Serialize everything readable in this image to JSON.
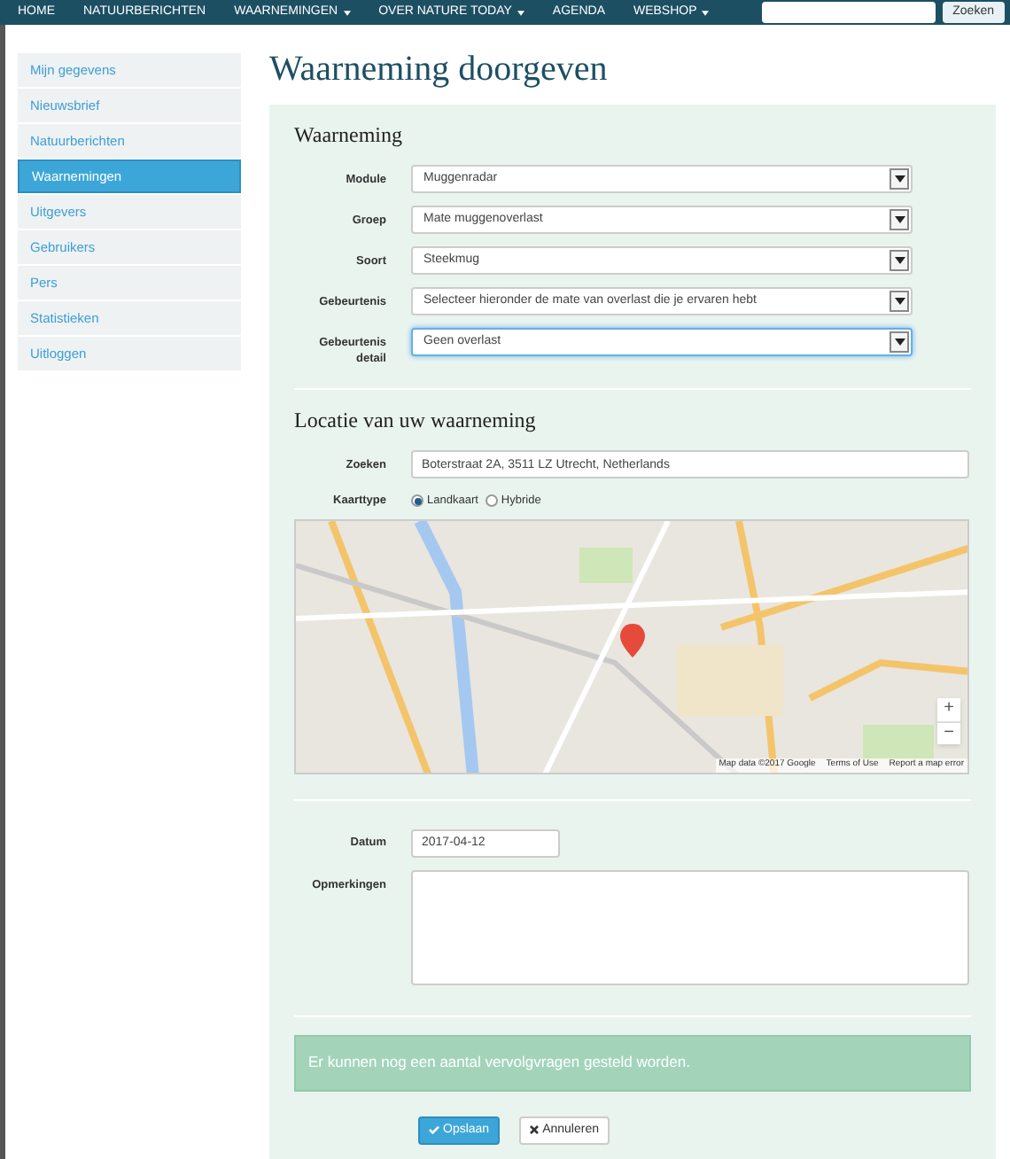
{
  "navbar": {
    "items": [
      {
        "label": "HOME",
        "dropdown": false
      },
      {
        "label": "NATUURBERICHTEN",
        "dropdown": false
      },
      {
        "label": "WAARNEMINGEN",
        "dropdown": true
      },
      {
        "label": "OVER NATURE TODAY",
        "dropdown": true
      },
      {
        "label": "AGENDA",
        "dropdown": false
      },
      {
        "label": "WEBSHOP",
        "dropdown": true
      }
    ],
    "search_button": "Zoeken"
  },
  "sidebar": {
    "items": [
      {
        "label": "Mijn gegevens",
        "selected": false
      },
      {
        "label": "Nieuwsbrief",
        "selected": false
      },
      {
        "label": "Natuurberichten",
        "selected": false
      },
      {
        "label": "Waarnemingen",
        "selected": true
      },
      {
        "label": "Uitgevers",
        "selected": false
      },
      {
        "label": "Gebruikers",
        "selected": false
      },
      {
        "label": "Pers",
        "selected": false
      },
      {
        "label": "Statistieken",
        "selected": false
      },
      {
        "label": "Uitloggen",
        "selected": false
      }
    ]
  },
  "page_title": "Waarneming doorgeven",
  "observation": {
    "heading": "Waarneming",
    "fields": [
      {
        "label": "Module",
        "value": "Muggenradar",
        "focused": false
      },
      {
        "label": "Groep",
        "value": "Mate muggenoverlast",
        "focused": false
      },
      {
        "label": "Soort",
        "value": "Steekmug",
        "focused": false
      },
      {
        "label": "Gebeurtenis",
        "value": "Selecteer hieronder de mate van overlast die je ervaren hebt",
        "focused": false
      },
      {
        "label": "Gebeurtenis detail",
        "value": "Geen overlast",
        "focused": true
      }
    ]
  },
  "location": {
    "heading": "Locatie van uw waarneming",
    "search_label": "Zoeken",
    "search_value": "Boterstraat 2A, 3511 LZ Utrecht, Netherlands",
    "map_type_label": "Kaarttype",
    "map_types": [
      {
        "label": "Landkaart",
        "selected": true
      },
      {
        "label": "Hybride",
        "selected": false
      }
    ],
    "map": {
      "zoom_in": "+",
      "zoom_out": "−",
      "attribution": [
        "Map data ©2017 Google",
        "Terms of Use",
        "Report a map error"
      ]
    }
  },
  "details": {
    "date_label": "Datum",
    "date_value": "2017-04-12",
    "remarks_label": "Opmerkingen"
  },
  "alert": "Er kunnen nog een aantal vervolgvragen gesteld worden.",
  "buttons": [
    {
      "label": "Opslaan",
      "kind": "primary"
    },
    {
      "label": "Annuleren",
      "kind": "secondary"
    }
  ]
}
